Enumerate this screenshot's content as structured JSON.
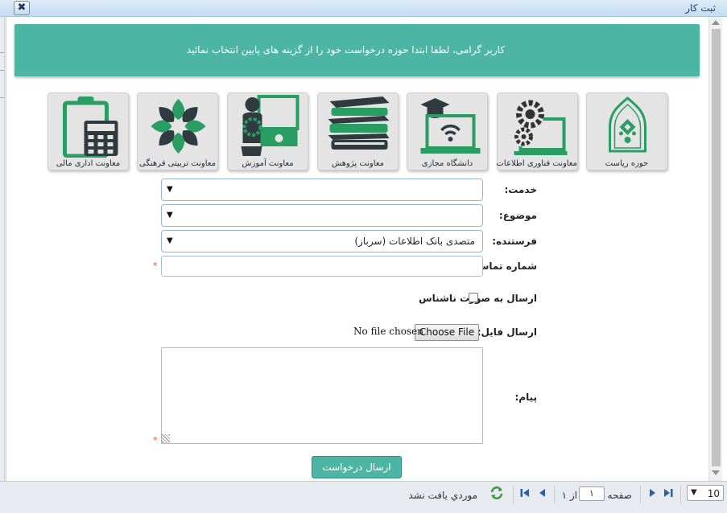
{
  "window": {
    "title": "ثبت کار",
    "close_symbol": "✖"
  },
  "banner": {
    "message": "کاربر گرامی، لطفا ابتدا حوزه درخواست خود را از گزینه های پایین انتخاب نمائید"
  },
  "tiles": [
    {
      "label": "حوزه ریاست",
      "icon": "mosque-emblem-icon"
    },
    {
      "label": "معاونت فناوری اطلاعات",
      "icon": "gears-monitor-icon"
    },
    {
      "label": "دانشگاه مجازی",
      "icon": "graduation-laptop-icon"
    },
    {
      "label": "معاونت پژوهش",
      "icon": "books-stack-icon"
    },
    {
      "label": "معاونت آموزش",
      "icon": "education-gears-icon"
    },
    {
      "label": "معاونت تربیتی فرهنگی",
      "icon": "islamic-ornament-icon"
    },
    {
      "label": "معاونت اداری مالی",
      "icon": "calculator-clipboard-icon"
    }
  ],
  "form": {
    "service_label": "خدمت:",
    "service_value": "",
    "subject_label": "موضوع:",
    "subject_value": "",
    "sender_label": "فرستنده:",
    "sender_value": "متصدی بانک اطلاعات (سرباز)",
    "phone_label": "شماره تماس:",
    "phone_value": "",
    "anonymous_label": "ارسال به صورت ناشناس",
    "file_label": "ارسال فایل:",
    "file_button": "Choose File",
    "file_status": "No file chosen",
    "message_label": "پیام:",
    "required_mark": "*",
    "submit_label": "ارسال درخواست",
    "select_arrow": "▼"
  },
  "pager": {
    "page_size": "10",
    "page_label": "صفحه",
    "page_value": "۱",
    "of_label": "از ۱",
    "status": "موردي يافت نشد"
  },
  "colors": {
    "accent": "#4cb5a4",
    "icon_green": "#2a9d63",
    "required": "#d0553a"
  }
}
